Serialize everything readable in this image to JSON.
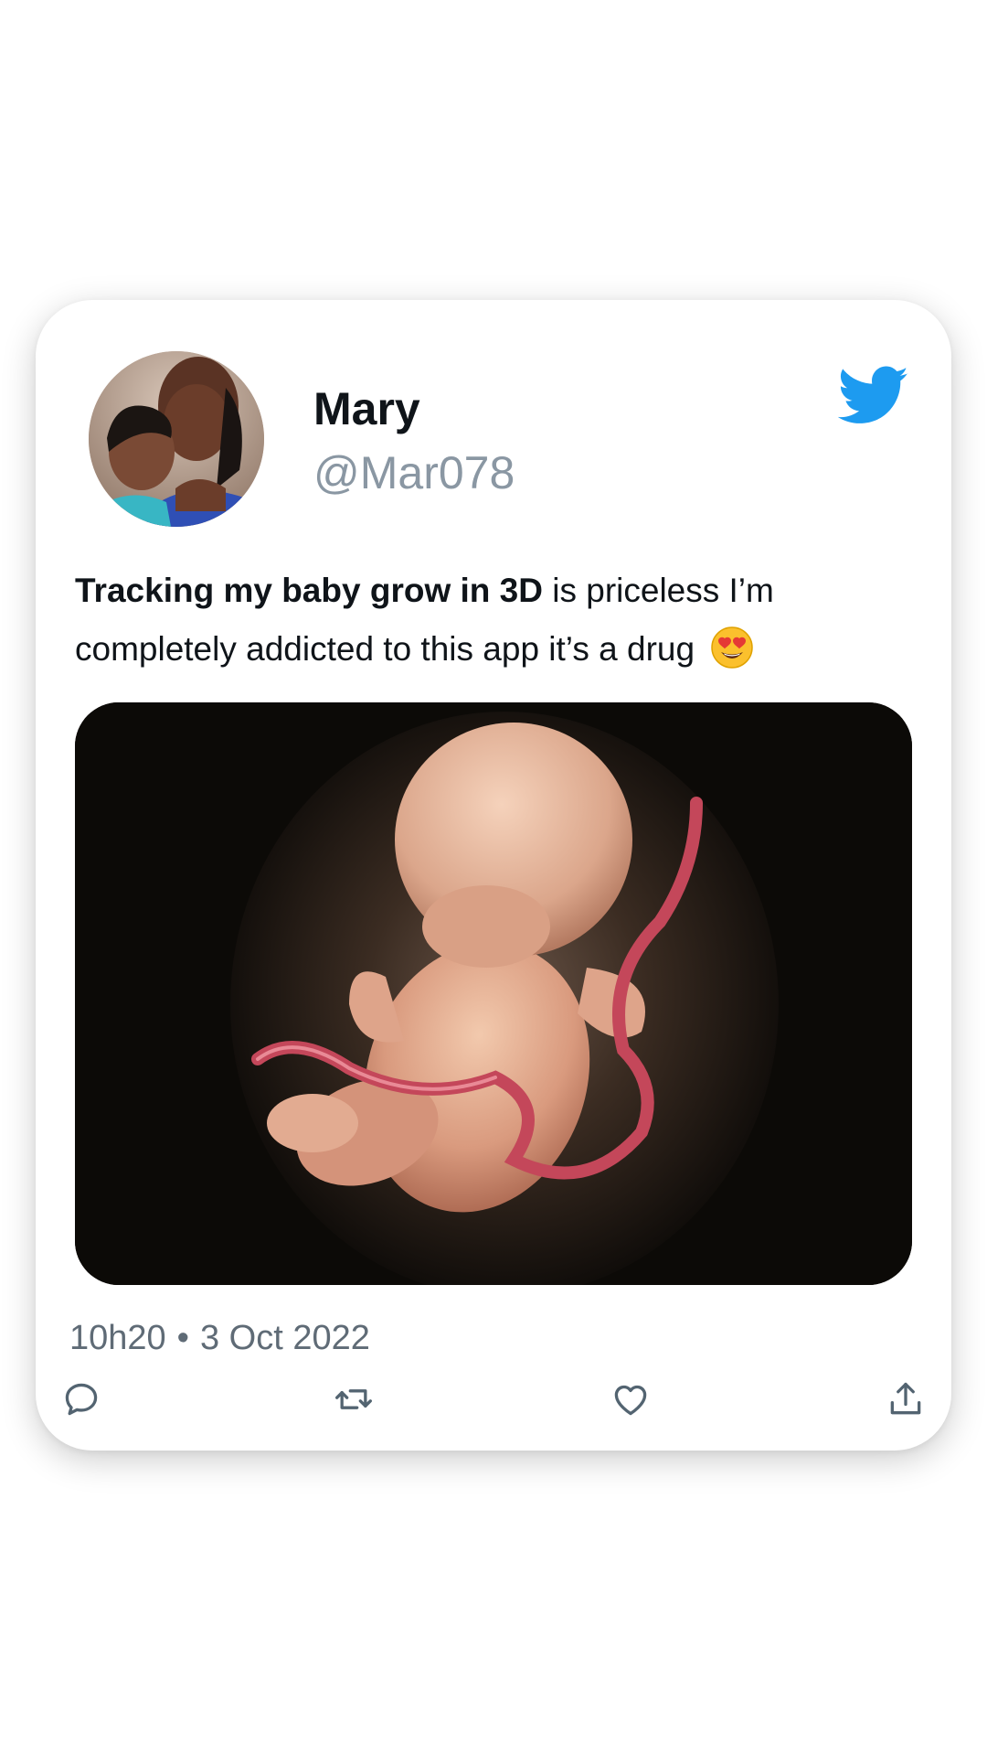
{
  "tweet": {
    "display_name": "Mary",
    "handle": "@Mar078",
    "text_bold": "Tracking my baby grow in 3D",
    "text_rest": " is priceless I’m completely addicted to this app it’s a drug ",
    "emoji": "heart-eyes-emoji",
    "media": "fetus-3d-render-image",
    "time": "10h20",
    "separator": "•",
    "date": "3 Oct 2022"
  },
  "icons": {
    "brand": "twitter-bird-icon",
    "reply": "reply-icon",
    "retweet": "retweet-icon",
    "like": "heart-icon",
    "share": "share-icon"
  },
  "colors": {
    "twitter_blue": "#1d9bf0",
    "text_primary": "#0f1419",
    "text_secondary": "#8a97a3",
    "icon_gray": "#536471"
  }
}
